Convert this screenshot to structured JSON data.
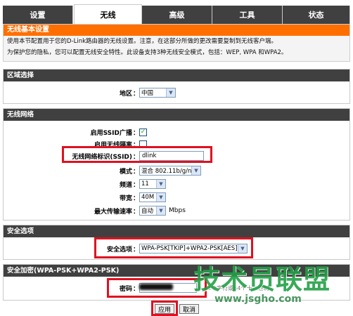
{
  "tabs": [
    "设置",
    "无线",
    "高级",
    "工具",
    "状态"
  ],
  "banner": {
    "title": "无线基本设置",
    "line1": "使用本节配置用于您的D-Link路由器的无线设置。注意，在这部分所做的更改需要复制到无线客户端。",
    "line2": "为保护您的隐私，您可以配置无线安全特性。此设备支持3种无线安全模式，包括：WEP, WPA 和WPA2。"
  },
  "region": {
    "heading": "区域选择",
    "label": "地区",
    "value": "中国"
  },
  "wireless": {
    "heading": "无线网络",
    "ssid_broadcast_label": "启用SSID广播",
    "ssid_broadcast_checked": "✓",
    "isolation_label": "启用无线隔离",
    "ssid_label": "无线网络标识(SSID)",
    "ssid_value": "dlink",
    "mode_label": "模式",
    "mode_value": "混合 802.11b/g/n",
    "channel_label": "频道",
    "channel_value": "11",
    "bandwidth_label": "带宽",
    "bandwidth_value": "40M",
    "rate_label": "最大传输速率",
    "rate_value": "自动",
    "rate_unit": "Mbps"
  },
  "security": {
    "heading": "安全选项",
    "label": "安全选项",
    "value": "WPA-PSK[TKIP]+WPA2-PSK[AES]"
  },
  "encryption": {
    "heading": "安全加密(WPA-PSK+WPA2-PSK)",
    "password_label": "密码",
    "password_hint": "8-63个字符或64个十六进制"
  },
  "buttons": {
    "apply": "应用",
    "cancel": "取消"
  },
  "watermark": {
    "cn": "技术员联盟",
    "url": "www.jsgho.com"
  },
  "colors": {
    "tab_bg": "#404040",
    "banner_title": "#ff6f00",
    "highlight": "#e01020",
    "watermark": "#23a046"
  }
}
